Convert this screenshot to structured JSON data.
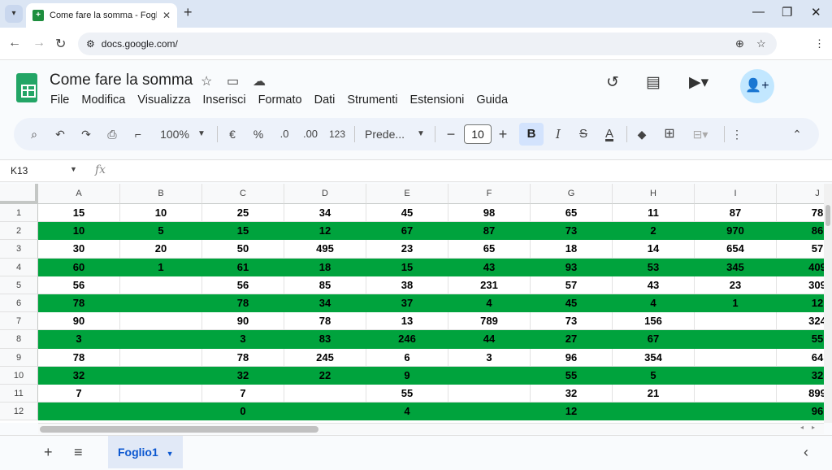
{
  "browser": {
    "tab_title": "Come fare la somma - Fogli Go",
    "url": "docs.google.com/",
    "new_tab_glyph": "+",
    "minimize_glyph": "—",
    "maximize_glyph": "❐",
    "close_glyph": "✕"
  },
  "doc": {
    "title": "Come fare la somma",
    "menu": [
      "File",
      "Modifica",
      "Visualizza",
      "Inserisci",
      "Formato",
      "Dati",
      "Strumenti",
      "Estensioni",
      "Guida"
    ]
  },
  "toolbar": {
    "zoom": "100%",
    "currency": "€",
    "percent": "%",
    "dec_decrease": ".0",
    "dec_increase": ".00",
    "format_number": "123",
    "font_name": "Prede...",
    "font_size": "10",
    "bold": "B",
    "italic": "I",
    "strike": "S",
    "text_color": "A"
  },
  "formula_bar": {
    "name_box": "K13",
    "fx": "fx"
  },
  "grid": {
    "columns": [
      "A",
      "B",
      "C",
      "D",
      "E",
      "F",
      "G",
      "H",
      "I",
      "J"
    ],
    "rows": [
      {
        "n": "1",
        "cells": [
          "15",
          "10",
          "25",
          "34",
          "45",
          "98",
          "65",
          "11",
          "87",
          "78"
        ]
      },
      {
        "n": "2",
        "cells": [
          "10",
          "5",
          "15",
          "12",
          "67",
          "87",
          "73",
          "2",
          "970",
          "86"
        ]
      },
      {
        "n": "3",
        "cells": [
          "30",
          "20",
          "50",
          "495",
          "23",
          "65",
          "18",
          "14",
          "654",
          "57"
        ]
      },
      {
        "n": "4",
        "cells": [
          "60",
          "1",
          "61",
          "18",
          "15",
          "43",
          "93",
          "53",
          "345",
          "409"
        ]
      },
      {
        "n": "5",
        "cells": [
          "56",
          "",
          "56",
          "85",
          "38",
          "231",
          "57",
          "43",
          "23",
          "309"
        ]
      },
      {
        "n": "6",
        "cells": [
          "78",
          "",
          "78",
          "34",
          "37",
          "4",
          "45",
          "4",
          "1",
          "12"
        ]
      },
      {
        "n": "7",
        "cells": [
          "90",
          "",
          "90",
          "78",
          "13",
          "789",
          "73",
          "156",
          "",
          "324"
        ]
      },
      {
        "n": "8",
        "cells": [
          "3",
          "",
          "3",
          "83",
          "246",
          "44",
          "27",
          "67",
          "",
          "55"
        ]
      },
      {
        "n": "9",
        "cells": [
          "78",
          "",
          "78",
          "245",
          "6",
          "3",
          "96",
          "354",
          "",
          "64"
        ]
      },
      {
        "n": "10",
        "cells": [
          "32",
          "",
          "32",
          "22",
          "9",
          "",
          "55",
          "5",
          "",
          "32"
        ]
      },
      {
        "n": "11",
        "cells": [
          "7",
          "",
          "7",
          "",
          "55",
          "",
          "32",
          "21",
          "",
          "899"
        ]
      },
      {
        "n": "12",
        "cells": [
          "",
          "",
          "0",
          "",
          "4",
          "",
          "12",
          "",
          "",
          "96"
        ]
      }
    ],
    "colors": {
      "green_row": "#00a33d",
      "white_row": "#ffffff"
    }
  },
  "sheets": {
    "active": "Foglio1"
  }
}
